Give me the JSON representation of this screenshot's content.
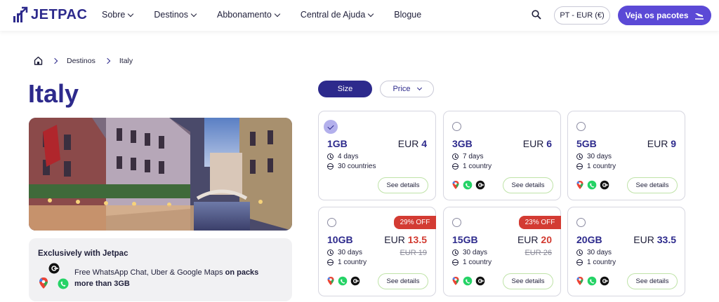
{
  "header": {
    "brand": "JETPAC",
    "nav": [
      "Sobre",
      "Destinos",
      "Abbonamento",
      "Central de Ajuda",
      "Blogue"
    ],
    "currency_label": "PT - EUR (€)",
    "cta_label": "Veja os pacotes"
  },
  "breadcrumb": {
    "items": [
      "Destinos",
      "Italy"
    ]
  },
  "page": {
    "title": "Italy"
  },
  "promo": {
    "title": "Exclusively with Jetpac",
    "text_prefix": "Free WhatsApp Chat, Uber & Google Maps ",
    "text_bold": "on packs more than 3GB"
  },
  "filters": {
    "size": "Size",
    "price": "Price"
  },
  "plans": [
    {
      "size": "1GB",
      "currency": "EUR",
      "price": "4",
      "days": "4 days",
      "countries": "30 countries",
      "selected": true,
      "apps": false,
      "discount": "",
      "old_price": "",
      "details": "See details"
    },
    {
      "size": "3GB",
      "currency": "EUR",
      "price": "6",
      "days": "7 days",
      "countries": "1 country",
      "selected": false,
      "apps": true,
      "discount": "",
      "old_price": "",
      "details": "See details"
    },
    {
      "size": "5GB",
      "currency": "EUR",
      "price": "9",
      "days": "30 days",
      "countries": "1 country",
      "selected": false,
      "apps": true,
      "discount": "",
      "old_price": "",
      "details": "See details"
    },
    {
      "size": "10GB",
      "currency": "EUR",
      "price": "13.5",
      "days": "30 days",
      "countries": "1 country",
      "selected": false,
      "apps": true,
      "discount": "29% OFF",
      "old_price": "EUR 19",
      "details": "See details"
    },
    {
      "size": "15GB",
      "currency": "EUR",
      "price": "20",
      "days": "30 days",
      "countries": "1 country",
      "selected": false,
      "apps": true,
      "discount": "23% OFF",
      "old_price": "EUR 26",
      "details": "See details"
    },
    {
      "size": "20GB",
      "currency": "EUR",
      "price": "33.5",
      "days": "30 days",
      "countries": "1 country",
      "selected": false,
      "apps": true,
      "discount": "",
      "old_price": "",
      "details": "See details"
    }
  ],
  "colors": {
    "brand": "#2d2a8c",
    "accent": "#5b49d6",
    "sale": "#d33b33",
    "details_border": "#bfe3a8"
  }
}
